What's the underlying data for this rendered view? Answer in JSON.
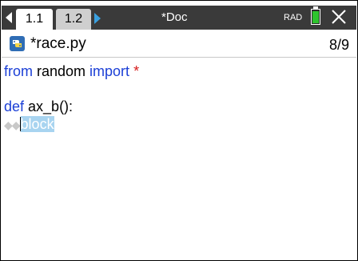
{
  "titlebar": {
    "tabs": [
      {
        "label": "1.1"
      },
      {
        "label": "1.2"
      }
    ],
    "doc_title": "*Doc",
    "mode": "RAD"
  },
  "filebar": {
    "filename": "*race.py",
    "position": "8/9"
  },
  "editor": {
    "line1": {
      "kw1": "from",
      "text1": " random ",
      "kw2": "import",
      "star": " *"
    },
    "line3": {
      "kw": "def",
      "text": " ax_b():"
    },
    "line4": {
      "dots": "◆◆",
      "selected": "block"
    }
  },
  "colors": {
    "titlebar_bg": "#3a3a3a",
    "keyword": "#1b3fd6",
    "star": "#d61b1b",
    "selection": "#a8d4f0",
    "battery": "#2ec42e",
    "nav_arrow_right": "#3aa0e0"
  },
  "icons": [
    "nav-left-icon",
    "nav-right-icon",
    "battery-icon",
    "close-icon",
    "python-file-icon"
  ]
}
